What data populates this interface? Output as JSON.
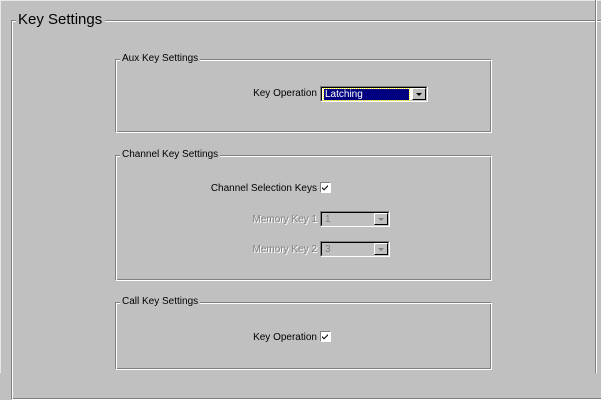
{
  "main_group": {
    "title": "Key Settings"
  },
  "aux_group": {
    "title": "Aux Key Settings",
    "key_operation_label": "Key Operation",
    "key_operation_value": "Latching"
  },
  "channel_group": {
    "title": "Channel Key Settings",
    "channel_selection_label": "Channel Selection Keys",
    "channel_selection_checked": true,
    "memory_key_1_label": "Memory Key 1",
    "memory_key_1_value": "1",
    "memory_key_2_label": "Memory Key 2",
    "memory_key_2_value": "3"
  },
  "call_group": {
    "title": "Call Key Settings",
    "key_operation_label": "Key Operation",
    "key_operation_checked": true
  },
  "icons": {
    "dropdown": "chevron-down-icon",
    "check": "checkmark-icon"
  }
}
